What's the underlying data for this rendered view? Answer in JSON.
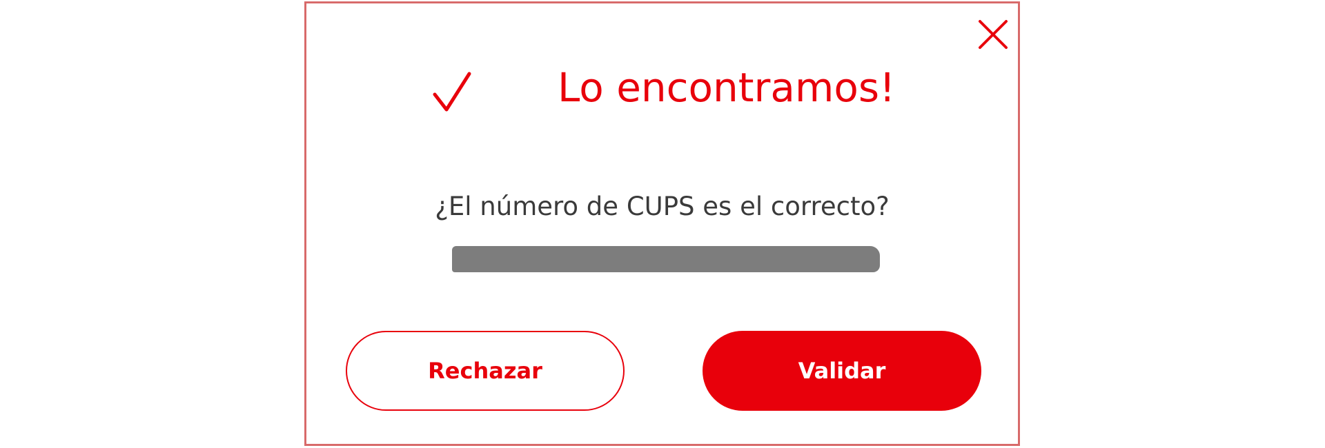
{
  "dialog": {
    "title": "Lo encontramos!",
    "question": "¿El número de CUPS es el correcto?",
    "cups_value_redacted": true,
    "icons": {
      "close": "close-icon",
      "check": "check-icon"
    },
    "buttons": {
      "reject_label": "Rechazar",
      "validate_label": "Validar"
    }
  },
  "colors": {
    "accent": "#e8000b",
    "text": "#3a3a3a",
    "border": "#d86a6a",
    "redaction": "#7d7d7d"
  }
}
